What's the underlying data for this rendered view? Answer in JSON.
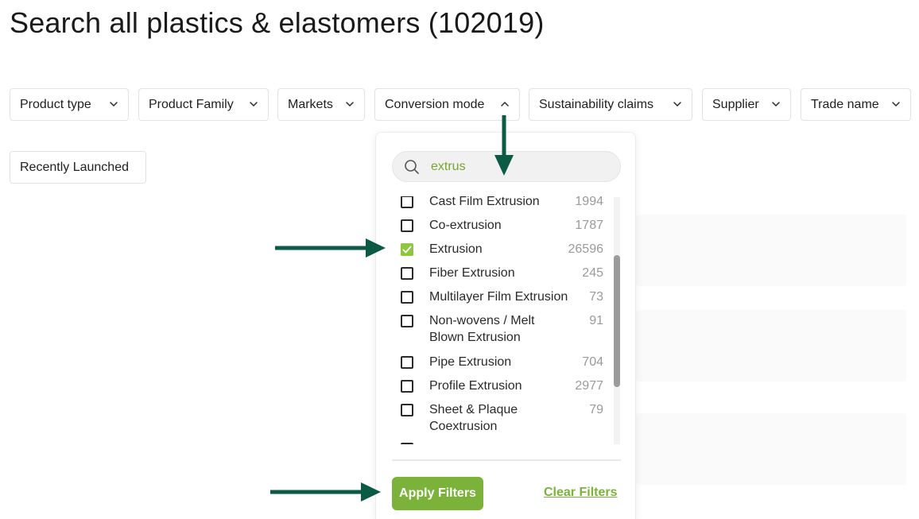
{
  "page": {
    "title": "Search all plastics & elastomers (102019)"
  },
  "filters": [
    {
      "label": "Product type",
      "expanded": false
    },
    {
      "label": "Product Family",
      "expanded": false
    },
    {
      "label": "Markets",
      "expanded": false
    },
    {
      "label": "Conversion mode",
      "expanded": true
    },
    {
      "label": "Sustainability claims",
      "expanded": false
    },
    {
      "label": "Supplier",
      "expanded": false
    },
    {
      "label": "Trade name",
      "expanded": false
    }
  ],
  "recently_launched": {
    "label": "Recently Launched"
  },
  "dropdown": {
    "search": {
      "value": "extrus"
    },
    "options": [
      {
        "label": "Cast Film Extrusion",
        "count": "1994",
        "checked": false
      },
      {
        "label": "Co-extrusion",
        "count": "1787",
        "checked": false
      },
      {
        "label": "Extrusion",
        "count": "26596",
        "checked": true
      },
      {
        "label": "Fiber Extrusion",
        "count": "245",
        "checked": false
      },
      {
        "label": "Multilayer Film Extrusion",
        "count": "73",
        "checked": false
      },
      {
        "label": "Non-wovens / Melt Blown Extrusion",
        "count": "91",
        "checked": false
      },
      {
        "label": "Pipe Extrusion",
        "count": "704",
        "checked": false
      },
      {
        "label": "Profile Extrusion",
        "count": "2977",
        "checked": false
      },
      {
        "label": "Sheet & Plaque Coextrusion",
        "count": "79",
        "checked": false
      }
    ],
    "apply_label": "Apply Filters",
    "clear_label": "Clear Filters"
  },
  "colors": {
    "accent_green": "#7bb23a",
    "search_text_green": "#7ba334",
    "annotation_arrow": "#0b5a44"
  },
  "icons": {
    "chevron_down": "chevron-down-icon",
    "chevron_up": "chevron-up-icon",
    "search": "search-icon",
    "check": "check-icon",
    "arrow": "arrow-icon"
  }
}
